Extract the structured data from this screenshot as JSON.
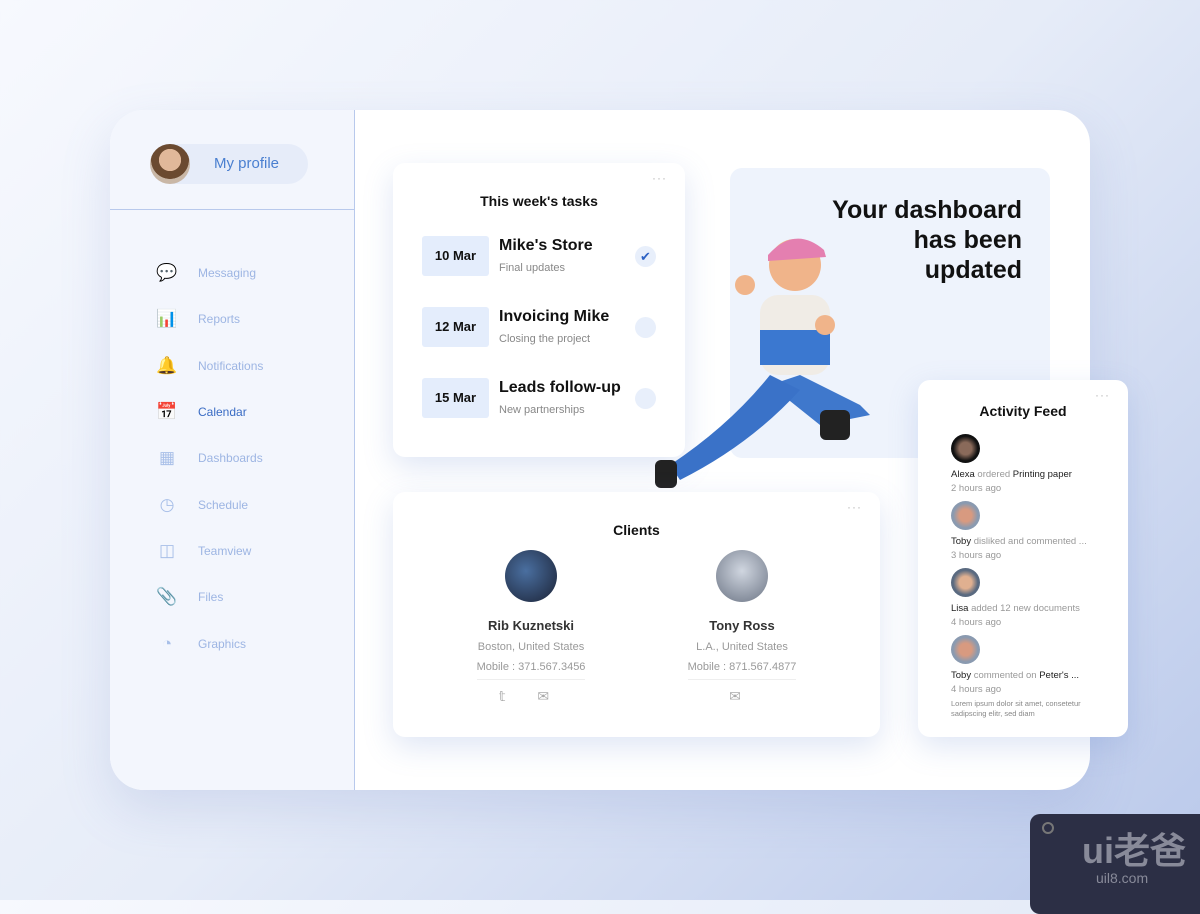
{
  "profile": {
    "label": "My profile"
  },
  "sidebar": {
    "items": [
      {
        "label": "Messaging",
        "icon": "chat-icon",
        "glyph": "💬"
      },
      {
        "label": "Reports",
        "icon": "bar-chart-icon",
        "glyph": "📊"
      },
      {
        "label": "Notifications",
        "icon": "bell-icon",
        "glyph": "🔔"
      },
      {
        "label": "Calendar",
        "icon": "calendar-icon",
        "glyph": "📅",
        "active": true
      },
      {
        "label": "Dashboards",
        "icon": "grid-icon",
        "glyph": "▦"
      },
      {
        "label": "Schedule",
        "icon": "clock-icon",
        "glyph": "◷"
      },
      {
        "label": "Teamview",
        "icon": "layout-icon",
        "glyph": "◫"
      },
      {
        "label": "Files",
        "icon": "paperclip-icon",
        "glyph": "📎"
      },
      {
        "label": "Graphics",
        "icon": "pie-chart-icon",
        "glyph": "◔"
      }
    ]
  },
  "tasks": {
    "title": "This week's tasks",
    "more": "···",
    "items": [
      {
        "date": "10 Mar",
        "name": "Mike's Store",
        "sub": "Final updates",
        "done": true
      },
      {
        "date": "12 Mar",
        "name": "Invoicing Mike",
        "sub": "Closing the project",
        "done": false
      },
      {
        "date": "15 Mar",
        "name": "Leads follow-up",
        "sub": "New partnerships",
        "done": false
      }
    ]
  },
  "banner": {
    "line1": "Your dashboard",
    "line2": "has been",
    "line3": "updated"
  },
  "clients": {
    "title": "Clients",
    "more": "···",
    "items": [
      {
        "name": "Rib Kuznetski",
        "location": "Boston, United States",
        "mobile": "Mobile : 371.567.3456",
        "icons": "𝕥 ✉"
      },
      {
        "name": "Tony Ross",
        "location": "L.A., United States",
        "mobile": "Mobile : 871.567.4877",
        "icons": "✉"
      }
    ]
  },
  "feed": {
    "title": "Activity Feed",
    "more": "···",
    "items": [
      {
        "user": "Alexa",
        "action": " ordered ",
        "object": "Printing paper",
        "time": "2 hours ago"
      },
      {
        "user": "Toby",
        "action": " disliked and commented ...",
        "object": "",
        "time": "3 hours ago"
      },
      {
        "user": "Lisa",
        "action": " added 12 new documents",
        "object": "",
        "time": "4 hours ago"
      },
      {
        "user": "Toby",
        "action": " commented on ",
        "object": "Peter's ...",
        "time": "4 hours ago",
        "note": "Lorem ipsum dolor sit amet, consetetur sadipscing elitr, sed diam"
      }
    ]
  },
  "watermark": {
    "logo": "ui老爸",
    "url": "uil8.com"
  },
  "colors": {
    "accent": "#3a6cc4",
    "nav": "#9db5e3",
    "date_bg": "#e4edfc"
  }
}
